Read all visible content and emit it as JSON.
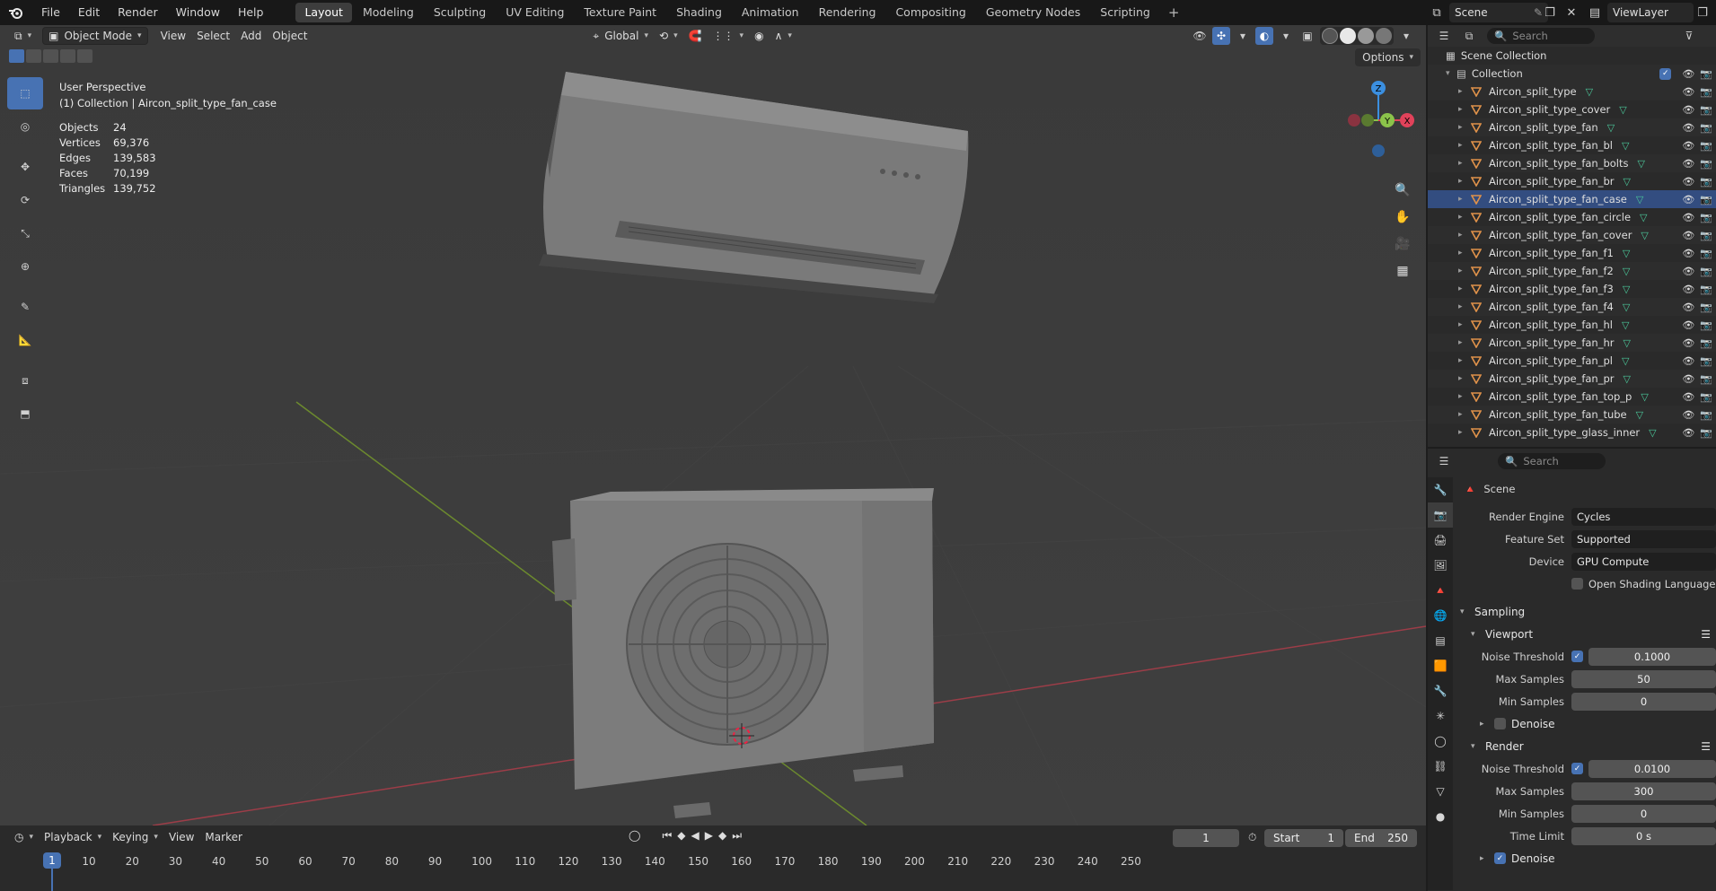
{
  "topbar": {
    "menus": [
      "File",
      "Edit",
      "Render",
      "Window",
      "Help"
    ],
    "workspaces": [
      "Layout",
      "Modeling",
      "Sculpting",
      "UV Editing",
      "Texture Paint",
      "Shading",
      "Animation",
      "Rendering",
      "Compositing",
      "Geometry Nodes",
      "Scripting"
    ],
    "active_workspace": "Layout",
    "scene": "Scene",
    "view_layer": "ViewLayer"
  },
  "viewport": {
    "mode": "Object Mode",
    "menus": [
      "View",
      "Select",
      "Add",
      "Object"
    ],
    "transform_orientation": "Global",
    "options_label": "Options",
    "perspective": "User Perspective",
    "active_object_line": "(1) Collection | Aircon_split_type_fan_case",
    "stats": [
      {
        "label": "Objects",
        "value": "24"
      },
      {
        "label": "Vertices",
        "value": "69,376"
      },
      {
        "label": "Edges",
        "value": "139,583"
      },
      {
        "label": "Faces",
        "value": "70,199"
      },
      {
        "label": "Triangles",
        "value": "139,752"
      }
    ],
    "gizmo_axes": {
      "x": "X",
      "y": "Y",
      "z": "Z"
    },
    "axis_colors": {
      "x": "#e1425a",
      "y": "#8bc34a",
      "z": "#3b8fe0"
    }
  },
  "outliner": {
    "search_placeholder": "Search",
    "scene_collection": "Scene Collection",
    "collection": "Collection",
    "objects": [
      "Aircon_split_type",
      "Aircon_split_type_cover",
      "Aircon_split_type_fan",
      "Aircon_split_type_fan_bl",
      "Aircon_split_type_fan_bolts",
      "Aircon_split_type_fan_br",
      "Aircon_split_type_fan_case",
      "Aircon_split_type_fan_circle",
      "Aircon_split_type_fan_cover",
      "Aircon_split_type_fan_f1",
      "Aircon_split_type_fan_f2",
      "Aircon_split_type_fan_f3",
      "Aircon_split_type_fan_f4",
      "Aircon_split_type_fan_hl",
      "Aircon_split_type_fan_hr",
      "Aircon_split_type_fan_pl",
      "Aircon_split_type_fan_pr",
      "Aircon_split_type_fan_top_p",
      "Aircon_split_type_fan_tube",
      "Aircon_split_type_glass_inner"
    ]
  },
  "properties": {
    "search_placeholder": "Search",
    "context": "Scene",
    "render_engine_label": "Render Engine",
    "render_engine": "Cycles",
    "feature_set_label": "Feature Set",
    "feature_set": "Supported",
    "device_label": "Device",
    "device": "GPU Compute",
    "osl_label": "Open Shading Language",
    "sampling": "Sampling",
    "viewport_panel": "Viewport",
    "render_panel": "Render",
    "noise_threshold_label": "Noise Threshold",
    "max_samples_label": "Max Samples",
    "min_samples_label": "Min Samples",
    "time_limit_label": "Time Limit",
    "denoise_label": "Denoise",
    "viewport_noise_threshold": "0.1000",
    "viewport_max_samples": "50",
    "viewport_min_samples": "0",
    "render_noise_threshold": "0.0100",
    "render_max_samples": "300",
    "render_min_samples": "0",
    "render_time_limit": "0 s"
  },
  "timeline": {
    "menus": [
      "Playback",
      "Keying",
      "View",
      "Marker"
    ],
    "current_frame": "1",
    "start_label": "Start",
    "start": "1",
    "end_label": "End",
    "end": "250",
    "ticks": [
      "10",
      "20",
      "30",
      "40",
      "50",
      "60",
      "70",
      "80",
      "90",
      "100",
      "110",
      "120",
      "130",
      "140",
      "150",
      "160",
      "170",
      "180",
      "190",
      "200",
      "210",
      "220",
      "230",
      "240",
      "250"
    ]
  }
}
